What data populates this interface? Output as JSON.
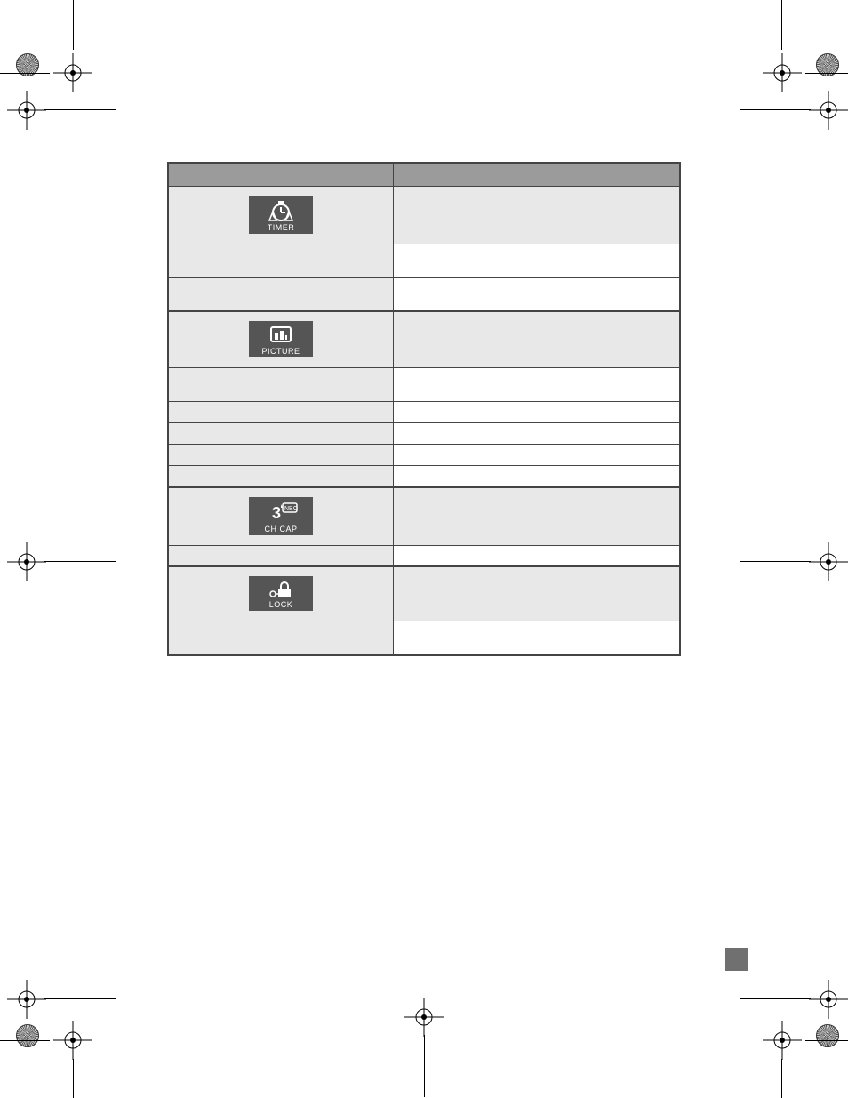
{
  "icons": {
    "timer": "TIMER",
    "picture": "PICTURE",
    "chcap": "CH CAP",
    "chcap_num": "3",
    "chcap_badge": "NBC",
    "lock": "LOCK"
  },
  "table": {
    "header_left": "",
    "header_right": ""
  }
}
